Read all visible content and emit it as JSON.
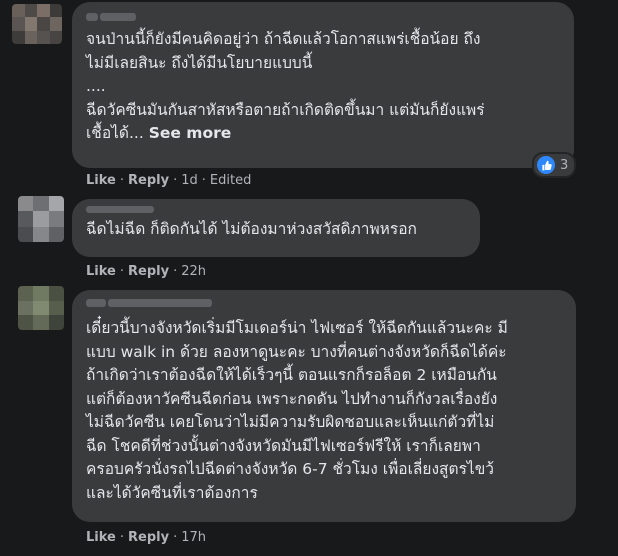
{
  "comments": [
    {
      "text": "จนป่านนี้ก็ยังมีคนคิดอยู่ว่า ถ้าฉีดแล้วโอกาสแพร่เชื้อน้อย ถึง\nไม่มีเลยสินะ ถึงได้มีนโยบายแบบนี้\n....\nฉีดวัคซีนมันกันสาหัสหรือตายถ้าเกิดติดขึ้นมา แต่มันก็ยังแพร่\nเชื้อได้...",
      "see_more": "See more",
      "reaction_count": "3",
      "reaction_icon": "like-icon",
      "like": "Like",
      "reply": "Reply",
      "time": "1d",
      "edited": "Edited"
    },
    {
      "text": "ฉีดไม่ฉีด ก็ติดกันได้ ไม่ต้องมาห่วงสวัสดิภาพหรอก",
      "like": "Like",
      "reply": "Reply",
      "time": "22h"
    },
    {
      "text": "เดี๋ยวนี้บางจังหวัดเริ่มมีโมเดอร์น่า ไฟเซอร์ ให้ฉีดกันแล้วนะคะ มี\nแบบ walk in ด้วย ลองหาดูนะคะ บางที่คนต่างจังหวัดก็ฉีดได้ค่ะ\nถ้าเกิดว่าเราต้องฉีดให้ได้เร็วๆนี้ ตอนแรกก็รอล็อต 2 เหมือนกัน\nแต่ก็ต้องหาวัคซีนฉีดก่อน เพราะกดดัน ไปทำงานก็กังวลเรื่องยัง\nไม่ฉีดวัคซีน เคยโดนว่าไม่มีความรับผิดชอบและเห็นแก่ตัวที่ไม่\nฉีด โชคดีที่ช่วงนั้นต่างจังหวัดมันมีไฟเซอร์ฟรีให้ เราก็เลยพา\nครอบครัวนั่งรถไปฉีดต่างจังหวัด 6-7 ชั่วโมง เพื่อเลี่ยงสูตรไขว้\nและได้วัคซีนที่เราต้องการ",
      "like": "Like",
      "reply": "Reply",
      "time": "17h"
    }
  ]
}
